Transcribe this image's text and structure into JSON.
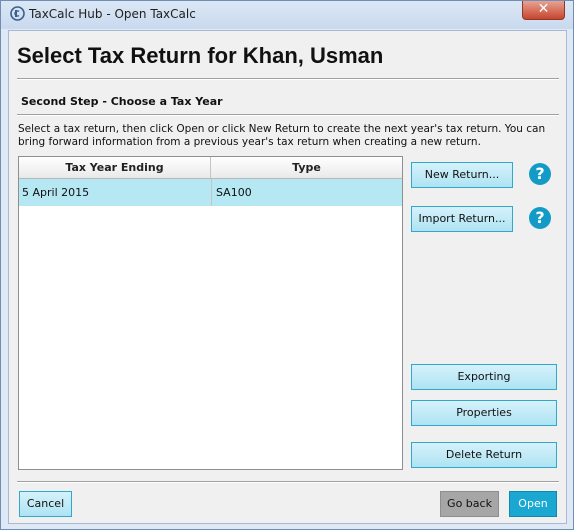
{
  "window": {
    "title": "TaxCalc Hub - Open TaxCalc",
    "close_glyph": "✕"
  },
  "header": {
    "title": "Select Tax Return for Khan, Usman",
    "step": "Second Step - Choose a Tax Year",
    "instructions": "Select a tax return, then click Open or click New Return to create the next year's tax return. You can bring forward information from a previous year's tax return when creating a new return."
  },
  "table": {
    "columns": [
      "Tax Year Ending",
      "Type"
    ],
    "rows": [
      {
        "tax_year_ending": "5 April 2015",
        "type": "SA100",
        "selected": true
      }
    ]
  },
  "actions": {
    "new_return": "New Return...",
    "import_return": "Import Return...",
    "help_glyph": "?",
    "exporting": "Exporting",
    "properties": "Properties",
    "delete_return": "Delete Return"
  },
  "footer": {
    "cancel": "Cancel",
    "go_back": "Go back",
    "open": "Open"
  },
  "colors": {
    "accent": "#1aa8d2",
    "selected_row": "#b5e8f3",
    "button_border": "#2fa8c9",
    "close": "#c7452e"
  },
  "icons": {
    "app": "taxcalc-logo-icon",
    "help": "help-icon",
    "close": "close-icon"
  }
}
